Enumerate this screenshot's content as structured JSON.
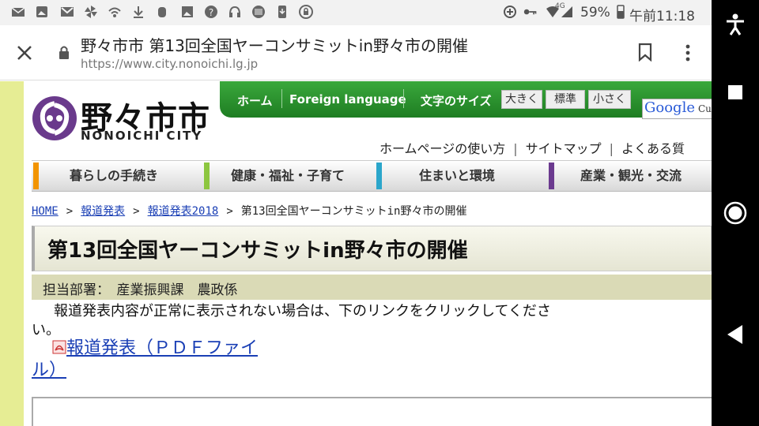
{
  "status_bar": {
    "battery": "59%",
    "network": "4G",
    "time": "午前11:18"
  },
  "browser": {
    "page_title": "野々市市 第13回全国ヤーコンサミットin野々市の開催",
    "url": "https://www.city.nonoichi.lg.jp"
  },
  "site": {
    "logo_ja": "野々市市",
    "logo_en": "NONOICHI CITY",
    "top_nav": [
      "ホーム",
      "Foreign language"
    ],
    "font_size_label": "文字のサイズ",
    "font_sizes": [
      "大きく",
      "標準",
      "小さく"
    ],
    "search_brand": "Google",
    "search_suffix": "Cu",
    "sub_links": [
      "ホームページの使い方",
      "サイトマップ",
      "よくある質"
    ],
    "categories": [
      {
        "label": "暮らしの手続き",
        "color": "#f29400"
      },
      {
        "label": "健康・福祉・子育て",
        "color": "#8cc63f"
      },
      {
        "label": "住まいと環境",
        "color": "#2ba6cb"
      },
      {
        "label": "産業・観光・交流",
        "color": "#6b3a8f"
      }
    ]
  },
  "breadcrumb": {
    "items": [
      "HOME",
      "報道発表",
      "報道発表2018"
    ],
    "sep": ">",
    "current": "第13回全国ヤーコンサミットin野々市の開催"
  },
  "article": {
    "heading": "第13回全国ヤーコンサミットin野々市の開催",
    "department": "担当部署：　産業振興課　農政係",
    "notice": "報道発表内容が正常に表示されない場合は、下のリンクをクリックしてください。",
    "pdf_link": "報道発表（ＰＤＦファイル）"
  }
}
